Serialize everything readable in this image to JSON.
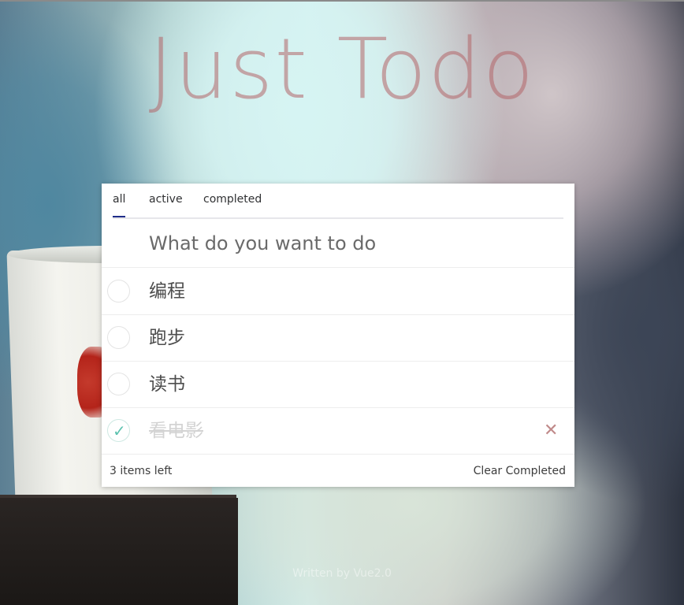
{
  "app": {
    "title": "Just Todo",
    "credit": "Written by Vue2.0"
  },
  "tabs": [
    {
      "label": "all",
      "selected": true
    },
    {
      "label": "active",
      "selected": false
    },
    {
      "label": "completed",
      "selected": false
    }
  ],
  "input": {
    "placeholder": "What do you want to do",
    "value": ""
  },
  "todos": [
    {
      "label": "编程",
      "completed": false
    },
    {
      "label": "跑步",
      "completed": false
    },
    {
      "label": "读书",
      "completed": false
    },
    {
      "label": "看电影",
      "completed": true
    }
  ],
  "footer": {
    "items_left": "3 items left",
    "clear_label": "Clear Completed"
  },
  "icons": {
    "check": "check-icon",
    "delete": "close-icon"
  },
  "colors": {
    "title": "#b26468",
    "accent_tab": "#1f2d8a",
    "check": "#5dc2af",
    "delete": "#c08a8a"
  }
}
